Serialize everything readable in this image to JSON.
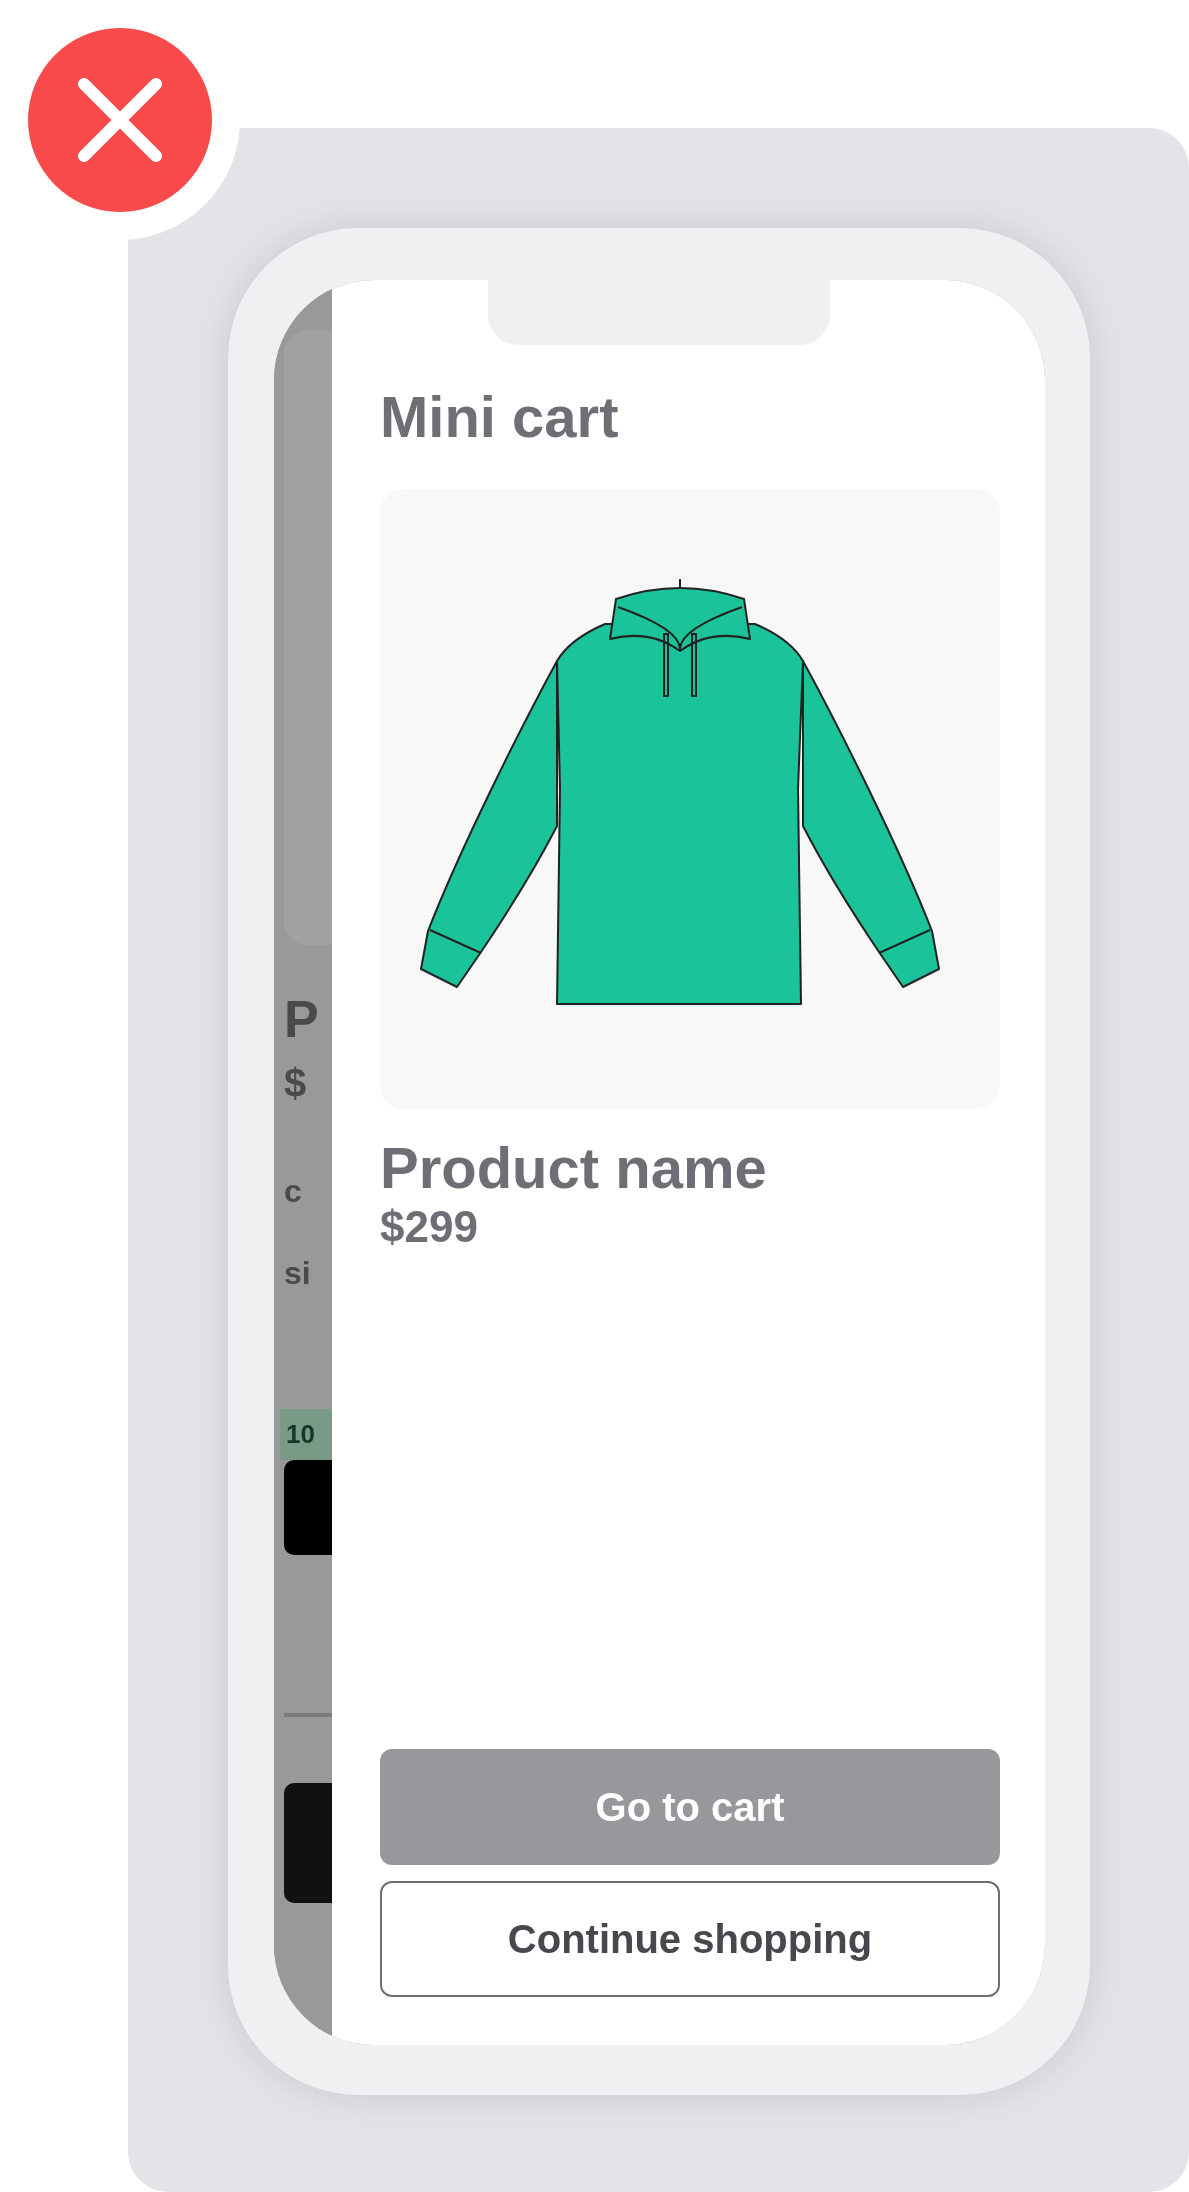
{
  "background_page": {
    "title_fragment": "P",
    "price_fragment": "$",
    "option_fragments": [
      "c",
      "si"
    ],
    "badge_fragment": "10"
  },
  "mini_cart": {
    "title": "Mini cart",
    "product": {
      "name": "Product name",
      "price": "$299"
    },
    "buttons": [
      {
        "label": "Go to cart",
        "kind": "primary"
      },
      {
        "label": "Continue shopping",
        "kind": "secondary"
      }
    ]
  }
}
